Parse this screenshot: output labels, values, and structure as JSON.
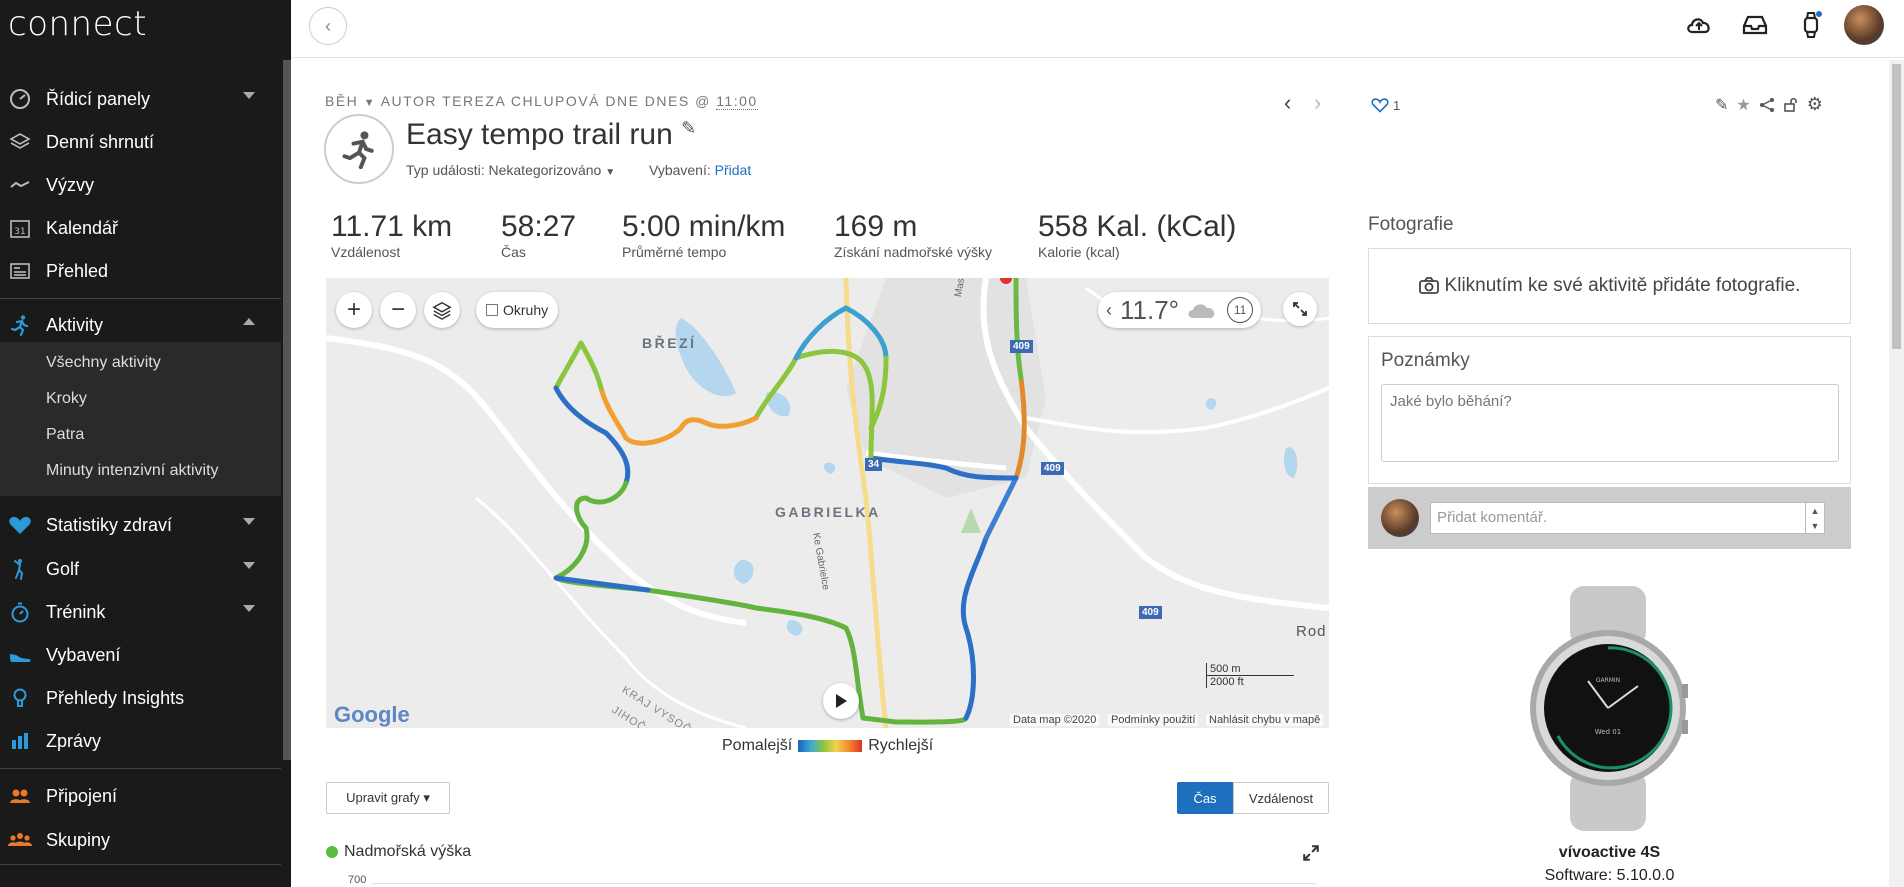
{
  "app": {
    "logo": "connect"
  },
  "sidebar": {
    "items": [
      {
        "label": "Řídicí panely",
        "icon": "gauge-icon",
        "expandable": true
      },
      {
        "label": "Denní shrnutí",
        "icon": "layers-icon",
        "expandable": false
      },
      {
        "label": "Výzvy",
        "icon": "trend-icon",
        "expandable": false
      },
      {
        "label": "Kalendář",
        "icon": "calendar-icon",
        "expandable": false
      },
      {
        "label": "Přehled",
        "icon": "newspaper-icon",
        "expandable": false
      },
      {
        "label": "Aktivity",
        "icon": "runner-icon",
        "expandable": true,
        "expanded": true
      },
      {
        "label": "Statistiky zdraví",
        "icon": "heart-icon",
        "expandable": true
      },
      {
        "label": "Golf",
        "icon": "golfer-icon",
        "expandable": true
      },
      {
        "label": "Trénink",
        "icon": "stopwatch-icon",
        "expandable": true
      },
      {
        "label": "Vybavení",
        "icon": "shoe-icon",
        "expandable": false
      },
      {
        "label": "Přehledy Insights",
        "icon": "bulb-icon",
        "expandable": false
      },
      {
        "label": "Zprávy",
        "icon": "bar-chart-icon",
        "expandable": false
      },
      {
        "label": "Připojení",
        "icon": "people-icon",
        "expandable": false
      },
      {
        "label": "Skupiny",
        "icon": "group-icon",
        "expandable": false
      }
    ],
    "activity_sub": [
      "Všechny aktivity",
      "Kroky",
      "Patra",
      "Minuty intenzivní aktivity"
    ],
    "calendar_day": "31"
  },
  "activity": {
    "type": "BĚH",
    "byline": "AUTOR TEREZA CHLUPOVÁ DNE DNES @",
    "time": "11:00",
    "title": "Easy tempo trail run",
    "event_type_label": "Typ události:",
    "event_type_value": "Nekategorizováno",
    "gear_label": "Vybavení:",
    "gear_link": "Přidat",
    "likes": "1"
  },
  "stats": [
    {
      "value": "11.71 km",
      "label": "Vzdálenost"
    },
    {
      "value": "58:27",
      "label": "Čas"
    },
    {
      "value": "5:00 min/km",
      "label": "Průměrné tempo"
    },
    {
      "value": "169 m",
      "label": "Získání nadmořské výšky"
    },
    {
      "value": "558 Kal. (kCal)",
      "label": "Kalorie (kcal)"
    }
  ],
  "map": {
    "okruhy": "Okruhy",
    "temperature": "11.7°",
    "wind": "11",
    "labels": {
      "brezi": "BŘEZÍ",
      "gabrielka": "GABRIELKA",
      "masarykova": "Masarykova",
      "ke_gabrielce": "Ke Gabrielce",
      "kraj": "KRAJ VYSOČI",
      "jihoc": "JIHOČ",
      "rod": "Rod"
    },
    "roads": [
      "409",
      "34",
      "409",
      "409"
    ],
    "google": "Google",
    "footer": [
      "Data map ©2020",
      "Podmínky použití",
      "Nahlásit chybu v mapě"
    ],
    "scale_m": "500 m",
    "scale_ft": "2000 ft",
    "colors": {
      "route_slow": "#1f5fbf",
      "route_mid": "#8cc63f",
      "route_fast": "#e0302a",
      "road_badge": "#3d6bb3"
    }
  },
  "legend": {
    "slow": "Pomalejší",
    "fast": "Rychlejší"
  },
  "charts": {
    "edit_button": "Upravit grafy ▾",
    "toggle_time": "Čas",
    "toggle_distance": "Vzdálenost",
    "elevation_title": "Nadmořská výška",
    "y_first_tick": "700"
  },
  "right": {
    "photos_title": "Fotografie",
    "photos_prompt": "Kliknutím ke své aktivitě přidáte fotografie.",
    "notes_title": "Poznámky",
    "notes_placeholder": "Jaké bylo běhání?",
    "comment_placeholder": "Přidat komentář.",
    "device_name": "vívoactive 4S",
    "device_software": "Software: 5.10.0.0",
    "watch_brand": "GARMIN",
    "watch_date": "Wed 01"
  },
  "accent": "#1f6fbf"
}
